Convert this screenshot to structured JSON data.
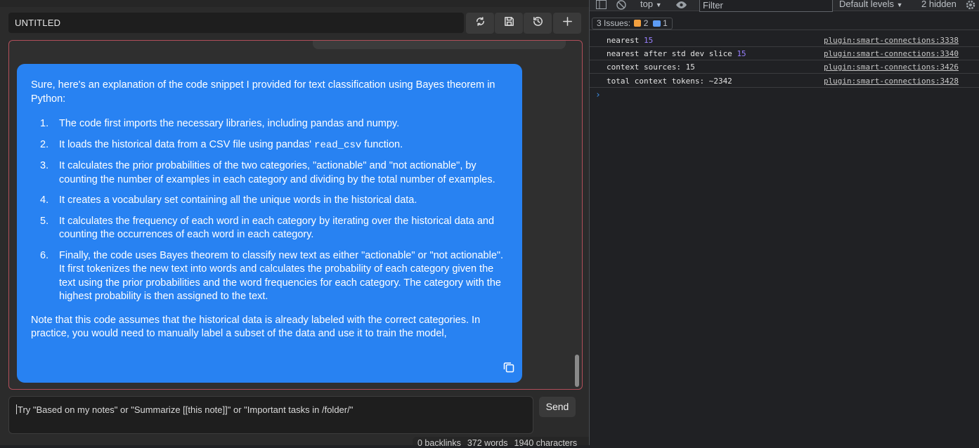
{
  "header": {
    "title": "UNTITLED",
    "buttons": [
      "refresh-icon",
      "save-icon",
      "history-icon",
      "plus-icon"
    ]
  },
  "message": {
    "intro": "Sure, here's an explanation of the code snippet I provided for text classification using Bayes theorem in Python:",
    "items": [
      {
        "num": "1.",
        "text": "The code first imports the necessary libraries, including pandas and numpy."
      },
      {
        "num": "2.",
        "pre": "It loads the historical data from a CSV file using pandas' ",
        "code": "read_csv",
        "post": " function."
      },
      {
        "num": "3.",
        "text": "It calculates the prior probabilities of the two categories, \"actionable\" and \"not actionable\", by counting the number of examples in each category and dividing by the total number of examples."
      },
      {
        "num": "4.",
        "text": "It creates a vocabulary set containing all the unique words in the historical data."
      },
      {
        "num": "5.",
        "text": "It calculates the frequency of each word in each category by iterating over the historical data and counting the occurrences of each word in each category."
      },
      {
        "num": "6.",
        "text": "Finally, the code uses Bayes theorem to classify new text as either \"actionable\" or \"not actionable\". It first tokenizes the new text into words and calculates the probability of each category given the text using the prior probabilities and the word frequencies for each category. The category with the highest probability is then assigned to the text."
      }
    ],
    "note": "Note that this code assumes that the historical data is already labeled with the correct categories. In practice, you would need to manually label a subset of the data and use it to train the model,"
  },
  "input": {
    "placeholder": "Try \"Based on my notes\" or \"Summarize [[this note]]\" or \"Important tasks in /folder/\"",
    "send_label": "Send"
  },
  "status": {
    "backlinks": "0 backlinks",
    "words": "372 words",
    "characters": "1940 characters"
  },
  "devtools": {
    "context": "top",
    "filter_placeholder": "Filter",
    "levels": "Default levels",
    "hidden": "2 hidden",
    "issues_label": "3 Issues:",
    "warn_count": "2",
    "info_count": "1",
    "logs": [
      {
        "text": "nearest ",
        "num": "15",
        "src": "plugin:smart-connections:3338"
      },
      {
        "text": "nearest after std dev slice ",
        "num": "15",
        "src": "plugin:smart-connections:3340"
      },
      {
        "text": "context sources: 15",
        "num": "",
        "src": "plugin:smart-connections:3426"
      },
      {
        "text": "total context tokens: ~2342",
        "num": "",
        "src": "plugin:smart-connections:3428"
      }
    ],
    "prompt": "›"
  },
  "colors": {
    "bubble": "#2882f2",
    "accent_border": "#b04f5a",
    "warn": "#f2a03f",
    "info": "#5d9cf5"
  }
}
